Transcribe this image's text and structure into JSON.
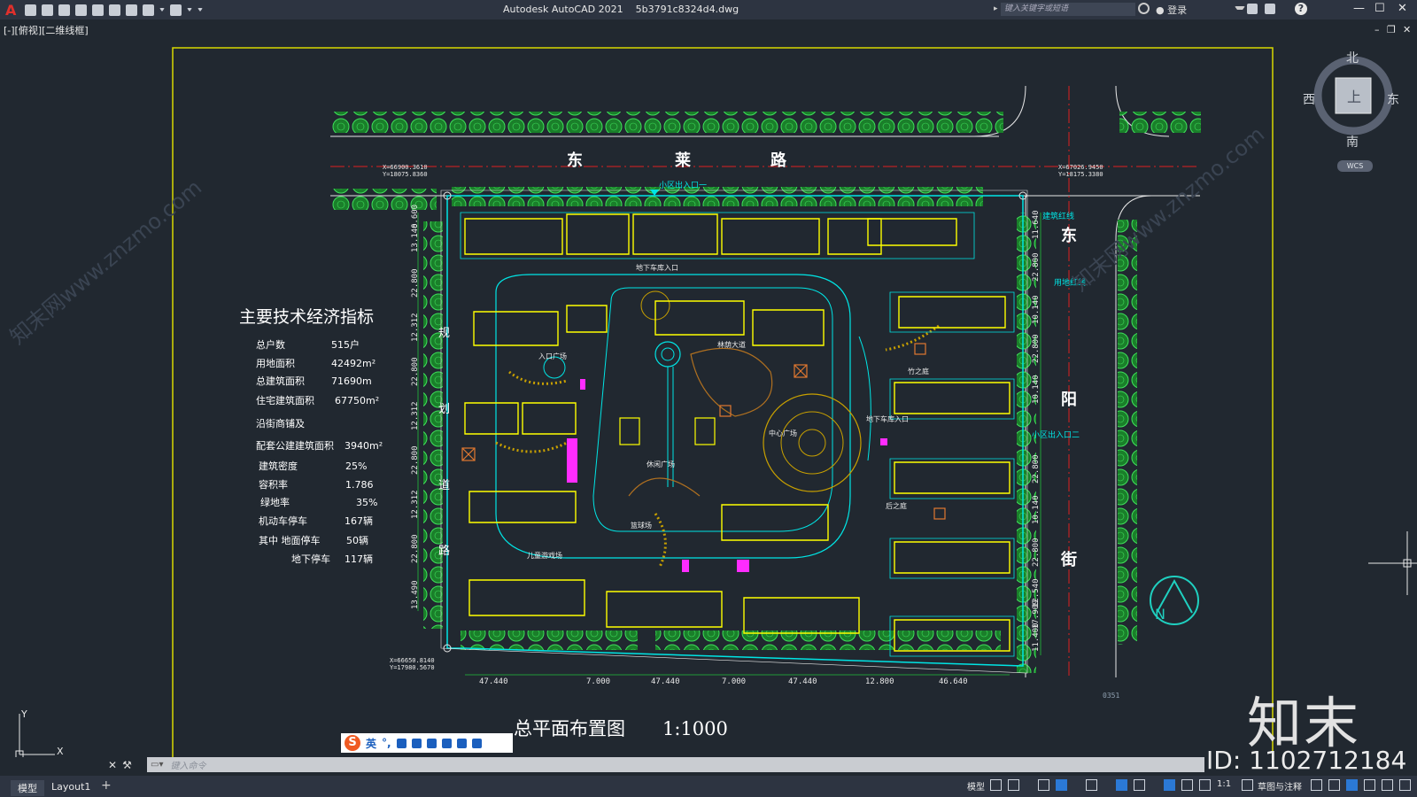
{
  "app": {
    "title": "Autodesk AutoCAD 2021",
    "file": "5b3791c8324d4.dwg",
    "search_placeholder": "键入关键字或短语",
    "login": "登录",
    "view_label": "[-][俯视][二维线框]"
  },
  "viewcube": {
    "north": "北",
    "south": "南",
    "east": "东",
    "west": "西",
    "top": "上",
    "wcs": "WCS"
  },
  "drawing": {
    "roads": {
      "top_road": [
        "东",
        "莱",
        "路"
      ],
      "right_road": [
        "东",
        "阳",
        "街"
      ],
      "left_road": [
        "规",
        "划",
        "道",
        "路"
      ]
    },
    "entrance_top": "小区出入口一",
    "entrance_right": "小区出入口二",
    "red_line_label": "建筑红线",
    "land_line_label": "用地红线",
    "coords": {
      "top_left": "X=66900.3610\nY=18075.8360",
      "top_right": "X=67026.9450\nY=18175.3380",
      "bottom_left": "X=66650.8140\nY=17980.5670"
    },
    "title": "总平面布置图",
    "scale": "1:1000",
    "bottom_dims": [
      "47.440",
      "7.000",
      "47.440",
      "7.000",
      "47.440",
      "12.800",
      "46.640"
    ],
    "left_dims": [
      "6.600",
      "13.140",
      "22.800",
      "12.312",
      "22.800",
      "12.312",
      "22.800",
      "12.312",
      "22.800",
      "13.490"
    ],
    "right_dims": [
      "11.640",
      "22.800",
      "10.140",
      "22.800",
      "10.140",
      "22.800",
      "10.140",
      "22.800",
      "12.540",
      "17.909",
      "11.400"
    ],
    "inner_labels": [
      "地下车库入口",
      "地下车库入口",
      "林荫大道",
      "竹之庭",
      "后之庭",
      "儿童游戏场",
      "篮球场",
      "休闲广场",
      "中心广场",
      "入口广场"
    ],
    "small_note": "0351"
  },
  "indicators": {
    "heading": "主要技术经济指标",
    "rows": [
      {
        "label": "总户数",
        "value": "515户"
      },
      {
        "label": "用地面积",
        "value": "42492m²"
      },
      {
        "label": "总建筑面积",
        "value": "71690m"
      },
      {
        "label": "住宅建筑面积",
        "value": "67750m²"
      },
      {
        "label": "沿街商铺及",
        "value": ""
      },
      {
        "label": "配套公建建筑面积",
        "value": "3940m²"
      },
      {
        "label": "建筑密度",
        "value": "25%"
      },
      {
        "label": "容积率",
        "value": "1.786"
      },
      {
        "label": "绿地率",
        "value": "35%"
      },
      {
        "label": "机动车停车",
        "value": "167辆"
      },
      {
        "label": "其中  地面停车",
        "value": "50辆"
      },
      {
        "label": "地下停车",
        "value": "117辆"
      }
    ]
  },
  "command": {
    "placeholder": "键入命令"
  },
  "ime": {
    "lang": "英"
  },
  "status": {
    "tabs": [
      "模型",
      "Layout1"
    ],
    "model_label": "模型",
    "scale": "1:1",
    "workspace": "草图与注释"
  },
  "watermark": {
    "brand": "知末",
    "id": "ID: 1102712184",
    "site": "知末网www.znzmo.com"
  },
  "colors": {
    "background": "#212830",
    "titlebar": "#2d3441",
    "building": "#ffff00",
    "outline": "#00e5e5",
    "tree": "#22c03a",
    "red": "#e02020",
    "magenta": "#ff2cff",
    "orange": "#e07830"
  }
}
